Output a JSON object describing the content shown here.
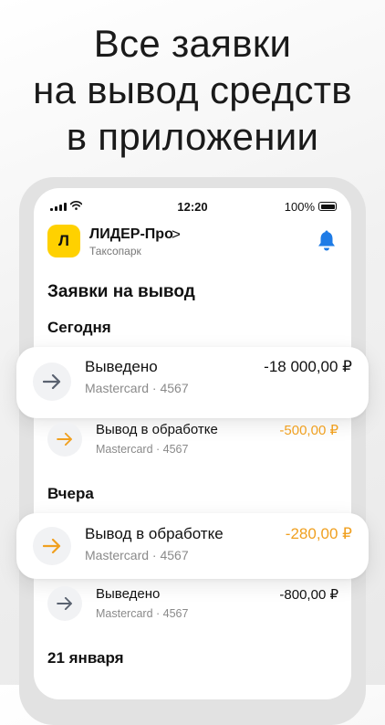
{
  "headline": {
    "line1": "Все заявки",
    "line2": "на вывод средств",
    "line3": "в приложении"
  },
  "status_bar": {
    "time": "12:20",
    "battery": "100%"
  },
  "org": {
    "logo_letter": "Л",
    "name": "ЛИДЕР-Про",
    "chevron": ">",
    "subtitle": "Таксопарк"
  },
  "page_title": "Заявки на вывод",
  "sections": {
    "today": "Сегодня",
    "yesterday": "Вчера",
    "jan21": "21 января"
  },
  "transactions": [
    {
      "status": "Выведено",
      "card": "Mastercard · 4567",
      "amount": "-18 000,00 ₽",
      "state": "done"
    },
    {
      "status": "Вывод в обработке",
      "card": "Mastercard · 4567",
      "amount": "-500,00 ₽",
      "state": "pending"
    },
    {
      "status": "Вывод в обработке",
      "card": "Mastercard · 4567",
      "amount": "-280,00 ₽",
      "state": "pending"
    },
    {
      "status": "Выведено",
      "card": "Mastercard · 4567",
      "amount": "-800,00 ₽",
      "state": "done"
    }
  ],
  "colors": {
    "accent_yellow": "#FFD100",
    "bell_blue": "#1E7BE6",
    "pending_orange": "#F0A020",
    "done_arrow_gray": "#5A6270"
  },
  "icons": {
    "bell": "bell-icon",
    "arrow_done": "arrow-right-icon",
    "arrow_pending": "arrow-right-icon"
  }
}
